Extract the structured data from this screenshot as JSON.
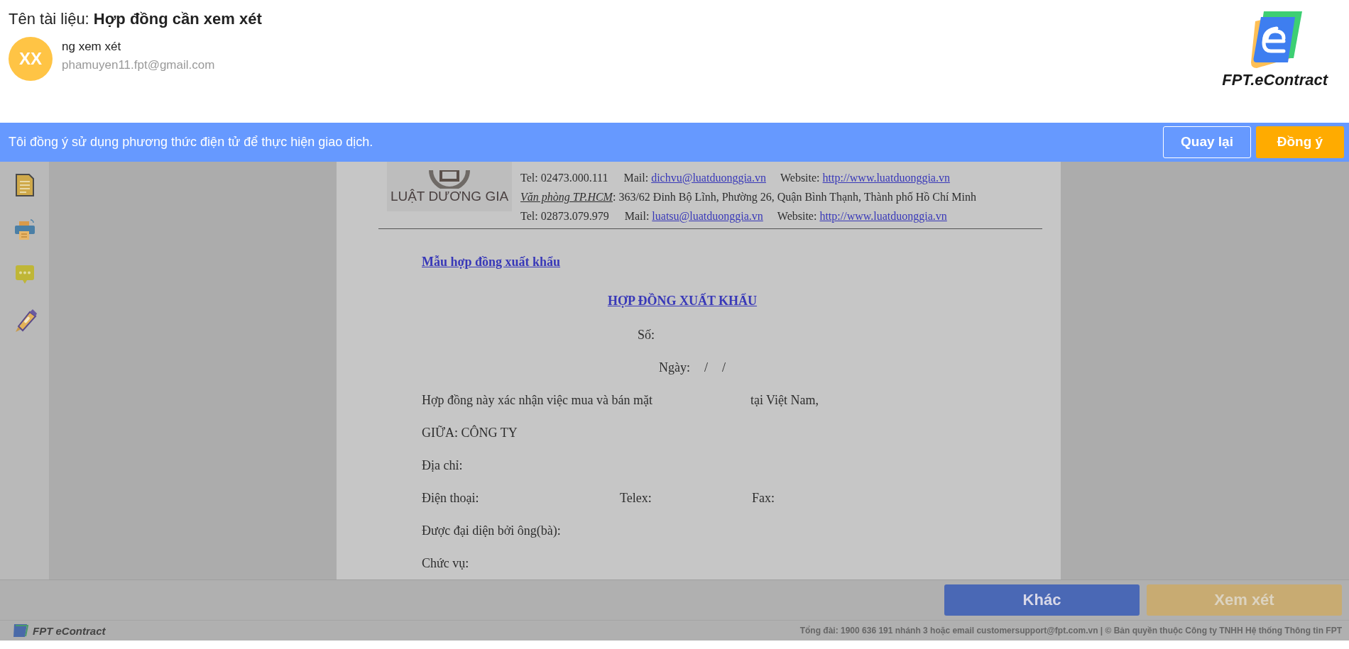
{
  "document_title": {
    "label": "Tên tài liệu:",
    "name": "Hợp đồng cần xem xét"
  },
  "reviewer": {
    "initials": "XX",
    "name": "ng xem xét",
    "email": "phamuyen11.fpt@gmail.com"
  },
  "brand": {
    "name": "FPT.eContract"
  },
  "consent_bar": {
    "text": "Tôi đồng ý sử dụng phương thức điện tử để thực hiện giao dịch.",
    "buttons": [
      {
        "label": "Quay lại",
        "kind": "outline"
      },
      {
        "label": "Đồng ý",
        "kind": "primary"
      }
    ]
  },
  "document": {
    "letterhead": {
      "logo_text": "LUẬT DƯƠNG GIA",
      "lines": [
        [
          {
            "text": "Tel: 02473.000.111",
            "kind": "plain"
          },
          {
            "text": "Mail:",
            "kind": "plain"
          },
          {
            "text": "dichvu@luatduonggia.vn",
            "kind": "link"
          },
          {
            "text": "Website:",
            "kind": "plain"
          },
          {
            "text": "http://www.luatduonggia.vn",
            "kind": "link"
          }
        ],
        [
          {
            "text": "Văn phòng TP.HCM",
            "kind": "label"
          },
          {
            "text": ": 363/62 Đinh Bộ Lĩnh, Phường 26, Quận Bình Thạnh, Thành phố Hồ Chí Minh",
            "kind": "plain"
          }
        ],
        [
          {
            "text": "Tel: 02873.079.979",
            "kind": "plain"
          },
          {
            "text": "Mail:",
            "kind": "plain"
          },
          {
            "text": "luatsu@luatduonggia.vn",
            "kind": "link"
          },
          {
            "text": "Website:",
            "kind": "plain"
          },
          {
            "text": "http://www.luatduonggia.vn",
            "kind": "link"
          }
        ]
      ]
    },
    "heading_link": "Mẫu hợp đồng xuất khẩu",
    "title": "HỢP ĐỒNG XUẤT KHẨU",
    "lines": [
      {
        "kind": "number",
        "parts": [
          "Số:"
        ]
      },
      {
        "kind": "date",
        "parts": [
          "Ngày:",
          "/",
          "/"
        ]
      },
      {
        "kind": "left",
        "parts": [
          "Hợp đồng này xác nhận việc mua và bán mặt",
          "tại Việt Nam,"
        ]
      },
      {
        "kind": "left",
        "parts": [
          "GIỮA: CÔNG TY"
        ]
      },
      {
        "kind": "left",
        "parts": [
          "Địa chỉ:"
        ]
      },
      {
        "kind": "left",
        "parts": [
          "Điện thoại:",
          "Telex:",
          "Fax:"
        ]
      },
      {
        "kind": "left",
        "parts": [
          "Được đại diện bởi ông(bà):"
        ]
      },
      {
        "kind": "left",
        "parts": [
          "Chức vụ:"
        ]
      }
    ]
  },
  "actions": [
    {
      "label": "Khác",
      "kind": "secondary"
    },
    {
      "label": "Xem xét",
      "kind": "primary"
    }
  ],
  "footer": {
    "brand": "FPT eContract",
    "text": "Tổng đài: 1900 636 191 nhánh 3 hoặc email customersupport@fpt.com.vn | © Bản quyền thuộc Công ty TNHH Hệ thống Thông tin FPT"
  }
}
